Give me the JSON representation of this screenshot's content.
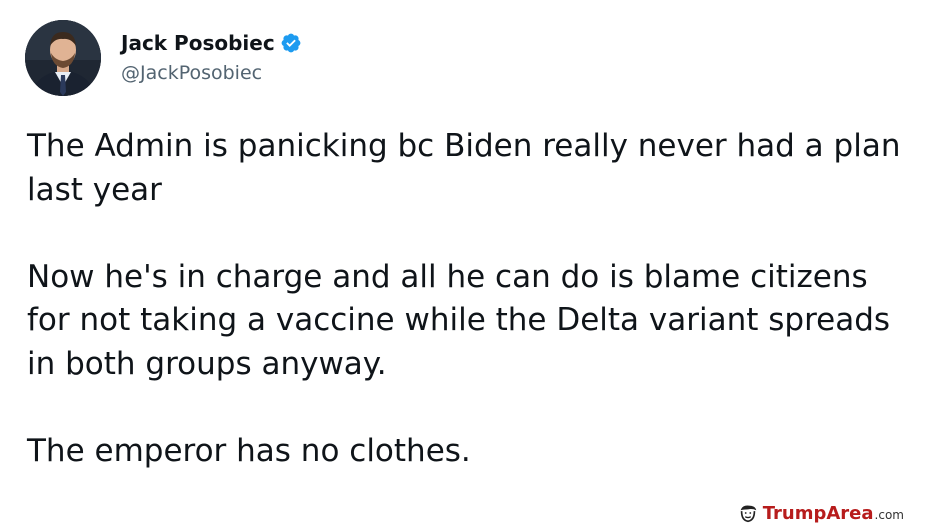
{
  "tweet": {
    "author": {
      "display_name": "Jack Posobiec",
      "handle": "@JackPosobiec",
      "verified": true
    },
    "paragraphs": [
      "The Admin is panicking bc Biden really never had a plan last year",
      "Now he's in charge and all he can do is blame citizens for not taking a vaccine while the Delta variant spreads in both groups anyway.",
      "The emperor has no clothes."
    ]
  },
  "watermark": {
    "brand_trump": "Trump",
    "brand_area": "Area",
    "brand_tld": ".com",
    "icon": "trump-face-icon"
  },
  "colors": {
    "verified_badge": "#1d9bf0",
    "handle_text": "#536471",
    "body_text": "#0f1419",
    "watermark_red": "#b71c1c"
  }
}
